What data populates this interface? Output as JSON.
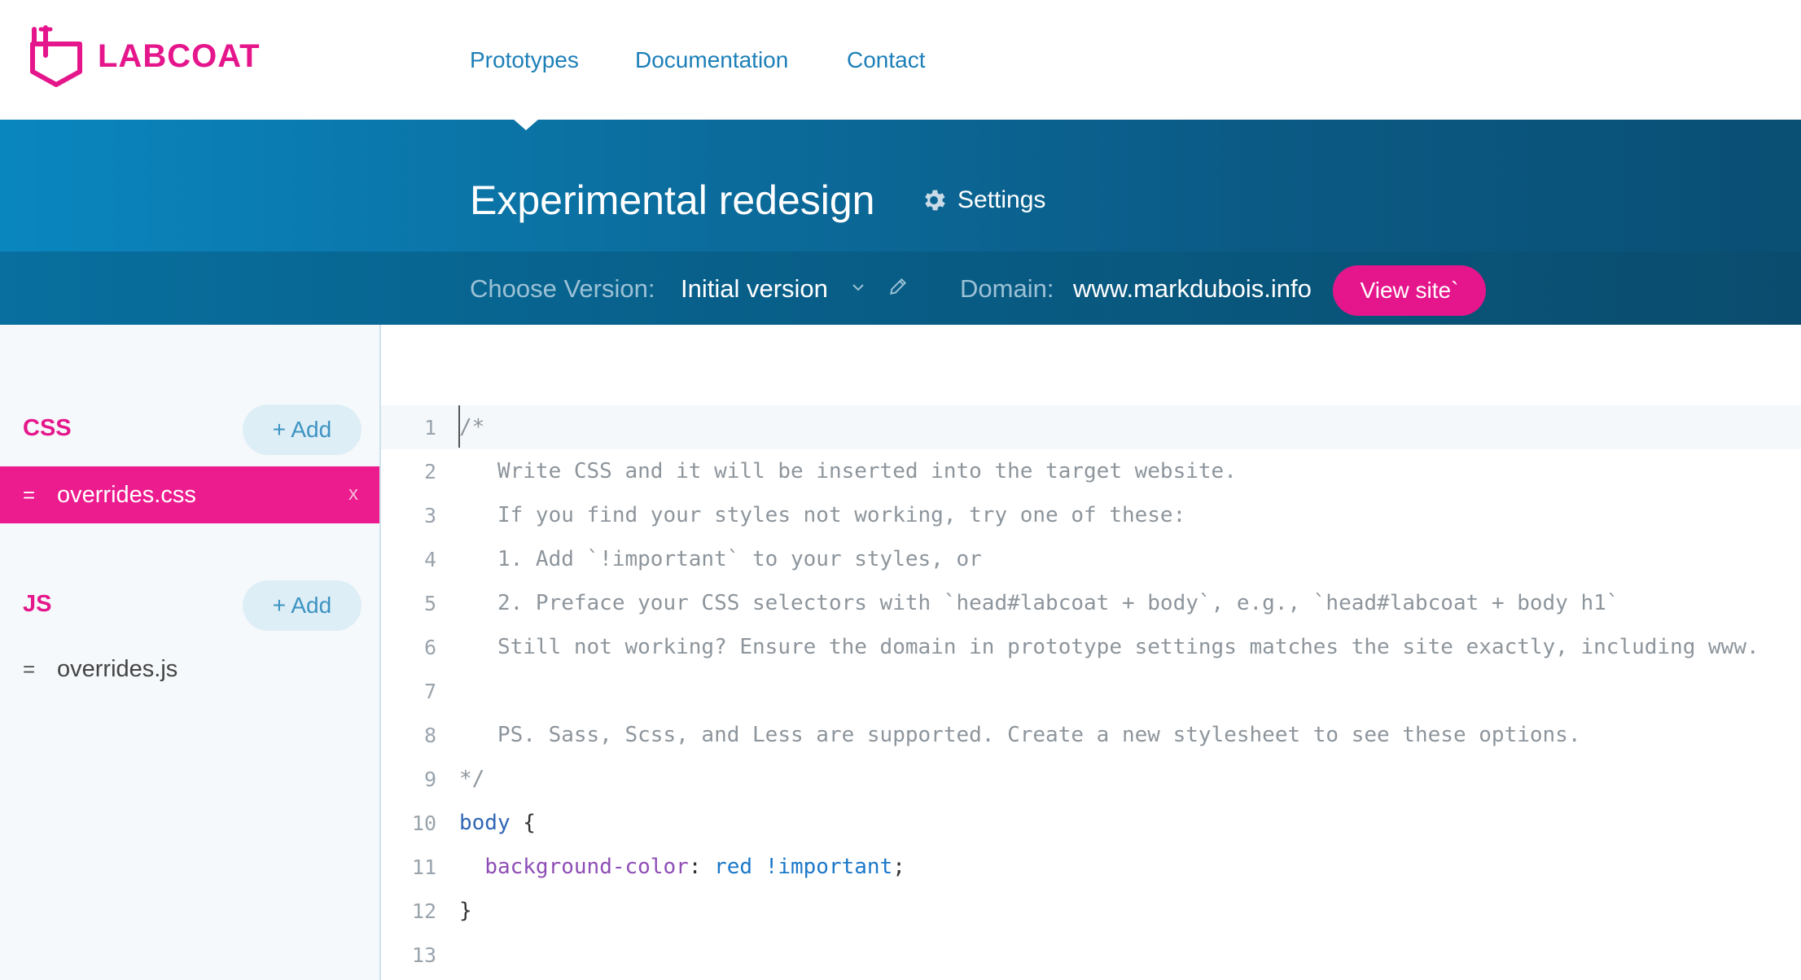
{
  "brand": {
    "name": "LABCOAT",
    "color": "#e5168b"
  },
  "nav": {
    "items": [
      "Prototypes",
      "Documentation",
      "Contact"
    ]
  },
  "header": {
    "title": "Experimental redesign",
    "settings_label": "Settings",
    "version_label": "Choose Version:",
    "version_value": "Initial version",
    "domain_label": "Domain:",
    "domain_value": "www.markdubois.info",
    "view_site_label": "View site`"
  },
  "sidebar": {
    "css": {
      "title": "CSS",
      "add_label": "+ Add",
      "files": [
        {
          "handle": "=",
          "name": "overrides.css",
          "close": "x"
        }
      ]
    },
    "js": {
      "title": "JS",
      "add_label": "+ Add",
      "files": [
        {
          "handle": "=",
          "name": "overrides.js"
        }
      ]
    }
  },
  "editor": {
    "current_line": 1,
    "lines": [
      {
        "n": "1",
        "text": "/*"
      },
      {
        "n": "2",
        "text": "   Write CSS and it will be inserted into the target website."
      },
      {
        "n": "3",
        "text": "   If you find your styles not working, try one of these:"
      },
      {
        "n": "4",
        "text": "   1. Add `!important` to your styles, or"
      },
      {
        "n": "5",
        "text": "   2. Preface your CSS selectors with `head#labcoat + body`, e.g., `head#labcoat + body h1`"
      },
      {
        "n": "6",
        "text": "   Still not working? Ensure the domain in prototype settings matches the site exactly, including www."
      },
      {
        "n": "7",
        "text": ""
      },
      {
        "n": "8",
        "text": "   PS. Sass, Scss, and Less are supported. Create a new stylesheet to see these options."
      },
      {
        "n": "9",
        "text": "*/"
      },
      {
        "n": "10",
        "selector": "body",
        "brace": "{"
      },
      {
        "n": "11",
        "prop": "background-color",
        "colon": ":",
        "value": "red !important",
        "semi": ";"
      },
      {
        "n": "12",
        "brace": "}"
      },
      {
        "n": "13",
        "text": ""
      }
    ]
  },
  "colors": {
    "accent": "#e5168b",
    "link": "#1c7fb8",
    "header_from": "#0a86bf",
    "header_to": "#0a4f74"
  }
}
